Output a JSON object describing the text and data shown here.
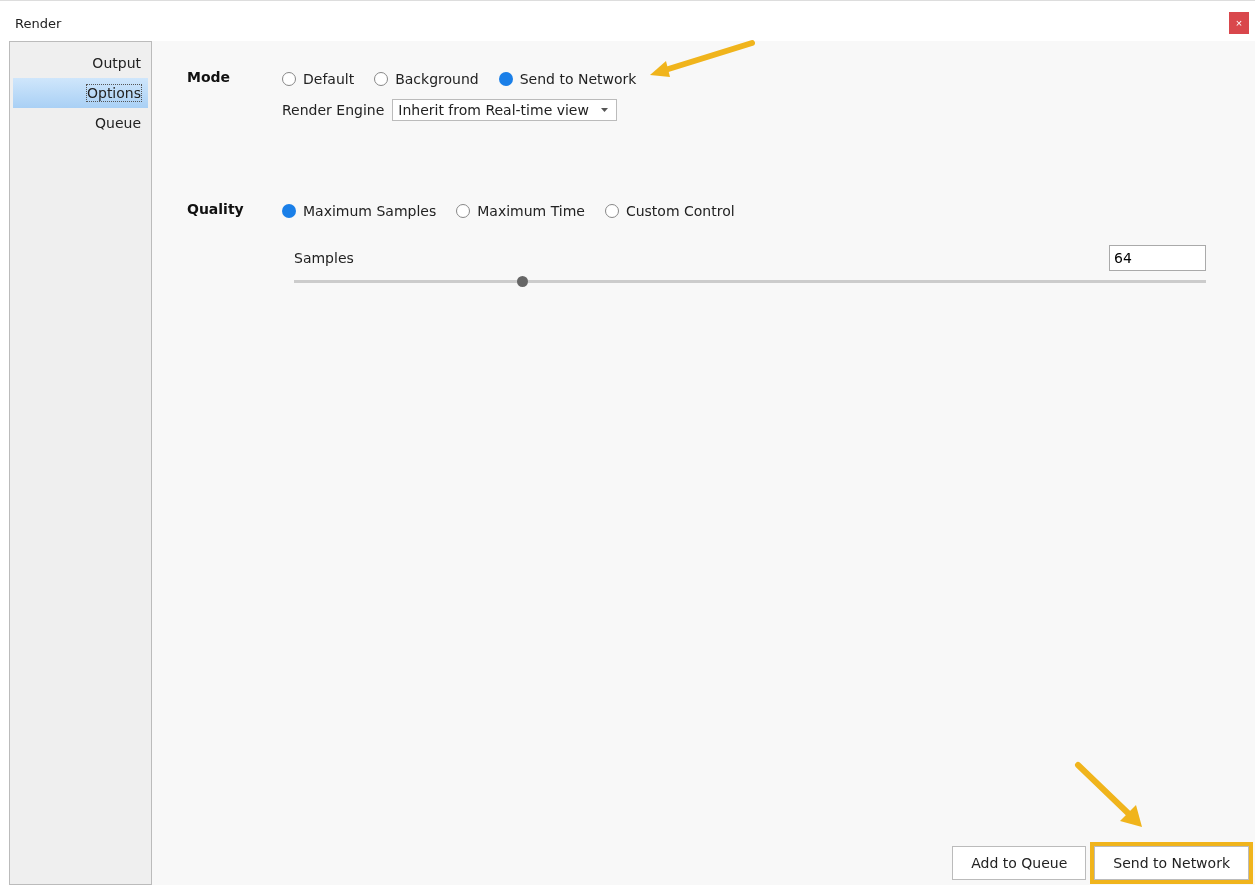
{
  "window": {
    "title": "Render",
    "close": "×"
  },
  "sidebar": {
    "items": [
      {
        "label": "Output",
        "selected": false
      },
      {
        "label": "Options",
        "selected": true
      },
      {
        "label": "Queue",
        "selected": false
      }
    ]
  },
  "mode": {
    "label": "Mode",
    "options": [
      {
        "label": "Default",
        "selected": false
      },
      {
        "label": "Background",
        "selected": false
      },
      {
        "label": "Send to Network",
        "selected": true
      }
    ],
    "engine": {
      "label": "Render Engine",
      "value": "Inherit from Real-time view"
    }
  },
  "quality": {
    "label": "Quality",
    "options": [
      {
        "label": "Maximum Samples",
        "selected": true
      },
      {
        "label": "Maximum Time",
        "selected": false
      },
      {
        "label": "Custom Control",
        "selected": false
      }
    ],
    "samples": {
      "label": "Samples",
      "value": "64",
      "level": 0.25
    }
  },
  "buttons": [
    {
      "label": "Add to Queue",
      "highlighted": false
    },
    {
      "label": "Send to Network",
      "highlighted": true
    }
  ]
}
